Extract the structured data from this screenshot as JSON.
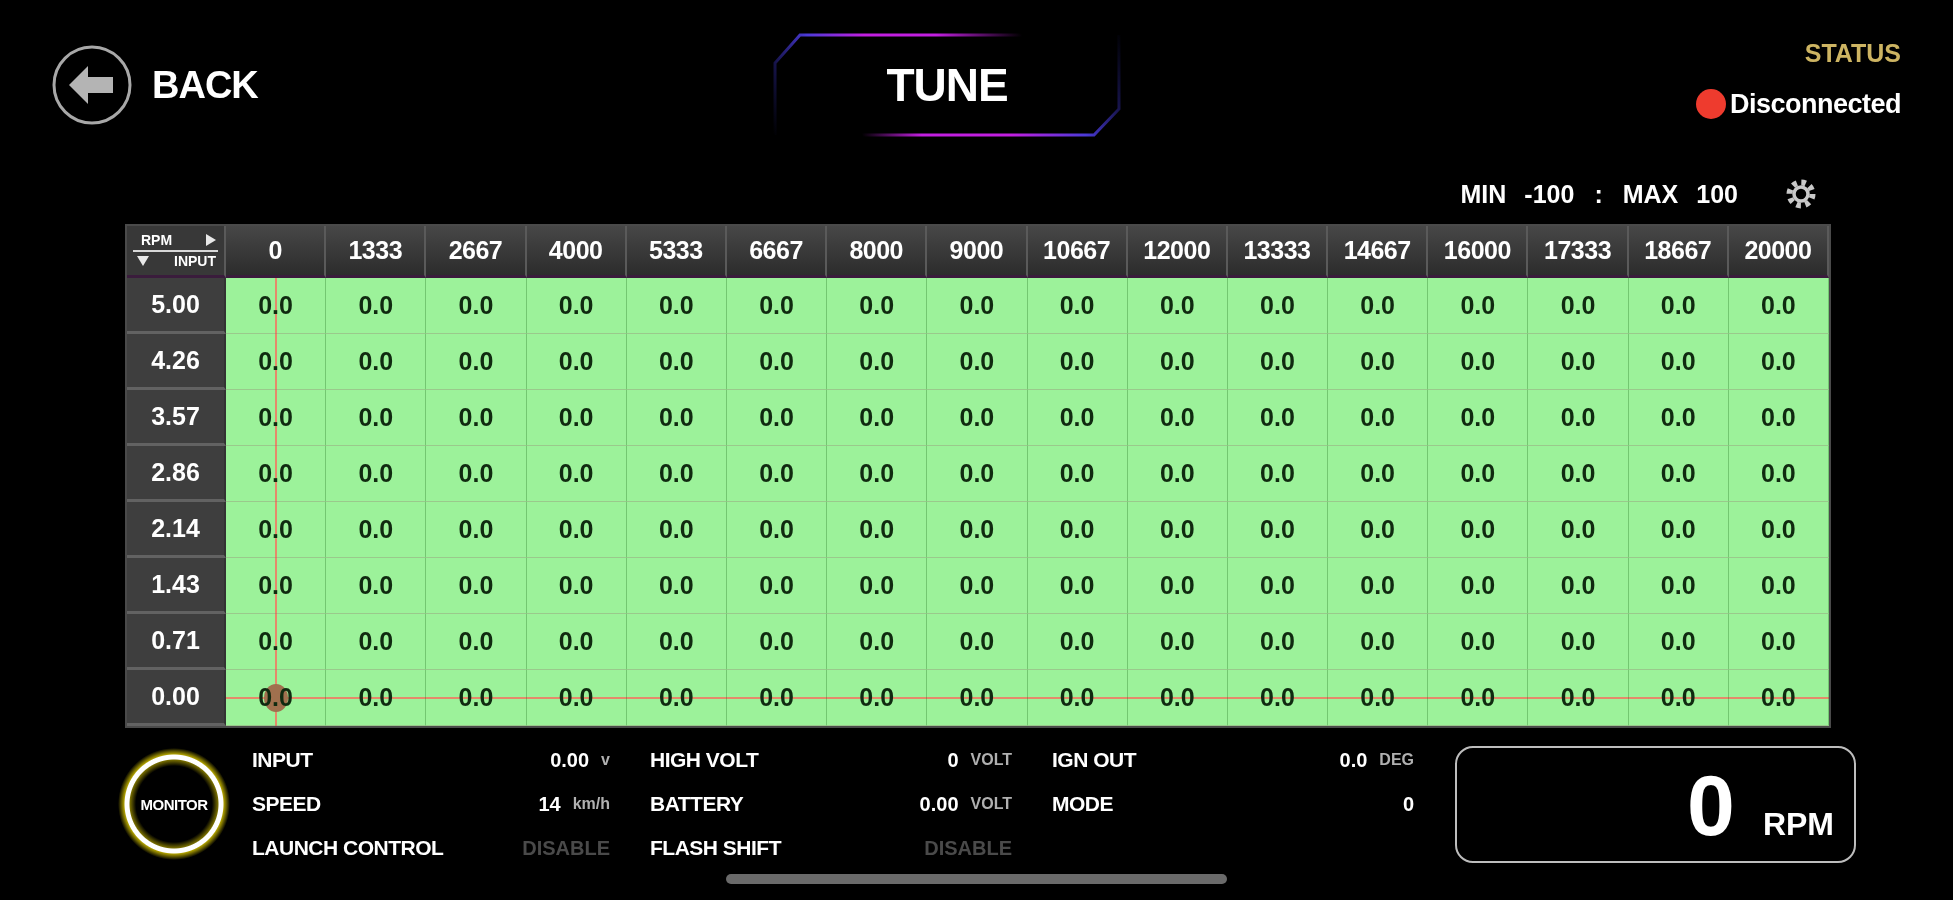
{
  "header": {
    "back": "BACK",
    "title": "TUNE",
    "status": {
      "heading": "STATUS",
      "text": "Disconnected",
      "connected": false
    }
  },
  "range": {
    "min_label": "MIN",
    "min": "-100",
    "separator": ":",
    "max_label": "MAX",
    "max": "100"
  },
  "table": {
    "corner": {
      "x_axis": "RPM",
      "y_axis": "INPUT"
    },
    "columns": [
      {
        "label": "0",
        "crosshair": true
      },
      {
        "label": "1333",
        "crosshair": false
      },
      {
        "label": "2667",
        "crosshair": false
      },
      {
        "label": "4000",
        "crosshair": false
      },
      {
        "label": "5333",
        "crosshair": false
      },
      {
        "label": "6667",
        "crosshair": false
      },
      {
        "label": "8000",
        "crosshair": false
      },
      {
        "label": "9000",
        "crosshair": false
      },
      {
        "label": "10667",
        "crosshair": false
      },
      {
        "label": "12000",
        "crosshair": false
      },
      {
        "label": "13333",
        "crosshair": false
      },
      {
        "label": "14667",
        "crosshair": false
      },
      {
        "label": "16000",
        "crosshair": false
      },
      {
        "label": "17333",
        "crosshair": false
      },
      {
        "label": "18667",
        "crosshair": false
      },
      {
        "label": "20000",
        "crosshair": false
      }
    ],
    "rows": [
      {
        "label": "5.00",
        "crosshair": false,
        "cells": [
          "0.0",
          "0.0",
          "0.0",
          "0.0",
          "0.0",
          "0.0",
          "0.0",
          "0.0",
          "0.0",
          "0.0",
          "0.0",
          "0.0",
          "0.0",
          "0.0",
          "0.0",
          "0.0"
        ]
      },
      {
        "label": "4.26",
        "crosshair": false,
        "cells": [
          "0.0",
          "0.0",
          "0.0",
          "0.0",
          "0.0",
          "0.0",
          "0.0",
          "0.0",
          "0.0",
          "0.0",
          "0.0",
          "0.0",
          "0.0",
          "0.0",
          "0.0",
          "0.0"
        ]
      },
      {
        "label": "3.57",
        "crosshair": false,
        "cells": [
          "0.0",
          "0.0",
          "0.0",
          "0.0",
          "0.0",
          "0.0",
          "0.0",
          "0.0",
          "0.0",
          "0.0",
          "0.0",
          "0.0",
          "0.0",
          "0.0",
          "0.0",
          "0.0"
        ]
      },
      {
        "label": "2.86",
        "crosshair": false,
        "cells": [
          "0.0",
          "0.0",
          "0.0",
          "0.0",
          "0.0",
          "0.0",
          "0.0",
          "0.0",
          "0.0",
          "0.0",
          "0.0",
          "0.0",
          "0.0",
          "0.0",
          "0.0",
          "0.0"
        ]
      },
      {
        "label": "2.14",
        "crosshair": false,
        "cells": [
          "0.0",
          "0.0",
          "0.0",
          "0.0",
          "0.0",
          "0.0",
          "0.0",
          "0.0",
          "0.0",
          "0.0",
          "0.0",
          "0.0",
          "0.0",
          "0.0",
          "0.0",
          "0.0"
        ]
      },
      {
        "label": "1.43",
        "crosshair": false,
        "cells": [
          "0.0",
          "0.0",
          "0.0",
          "0.0",
          "0.0",
          "0.0",
          "0.0",
          "0.0",
          "0.0",
          "0.0",
          "0.0",
          "0.0",
          "0.0",
          "0.0",
          "0.0",
          "0.0"
        ]
      },
      {
        "label": "0.71",
        "crosshair": false,
        "cells": [
          "0.0",
          "0.0",
          "0.0",
          "0.0",
          "0.0",
          "0.0",
          "0.0",
          "0.0",
          "0.0",
          "0.0",
          "0.0",
          "0.0",
          "0.0",
          "0.0",
          "0.0",
          "0.0"
        ]
      },
      {
        "label": "0.00",
        "crosshair": true,
        "cells": [
          "0.0",
          "0.0",
          "0.0",
          "0.0",
          "0.0",
          "0.0",
          "0.0",
          "0.0",
          "0.0",
          "0.0",
          "0.0",
          "0.0",
          "0.0",
          "0.0",
          "0.0",
          "0.0"
        ]
      }
    ]
  },
  "monitor": {
    "button": "MONITOR",
    "groups": [
      {
        "items": [
          {
            "label": "INPUT",
            "value": "0.00",
            "unit": "v",
            "dimmed": false
          },
          {
            "label": "SPEED",
            "value": "14",
            "unit": "km/h",
            "dimmed": false
          },
          {
            "label": "LAUNCH CONTROL",
            "value": "DISABLE",
            "dimmed": true
          }
        ]
      },
      {
        "items": [
          {
            "label": "HIGH VOLT",
            "value": "0",
            "unit": "VOLT",
            "dimmed": false
          },
          {
            "label": "BATTERY",
            "value": "0.00",
            "unit": "VOLT",
            "dimmed": false
          },
          {
            "label": "FLASH SHIFT",
            "value": "DISABLE",
            "dimmed": true
          }
        ]
      },
      {
        "items": [
          {
            "label": "IGN OUT",
            "value": "0.0",
            "unit": "DEG",
            "dimmed": false
          },
          {
            "label": "MODE",
            "value": "0",
            "dimmed": false
          }
        ]
      }
    ]
  },
  "rpm_display": {
    "value": "0",
    "unit": "RPM"
  }
}
